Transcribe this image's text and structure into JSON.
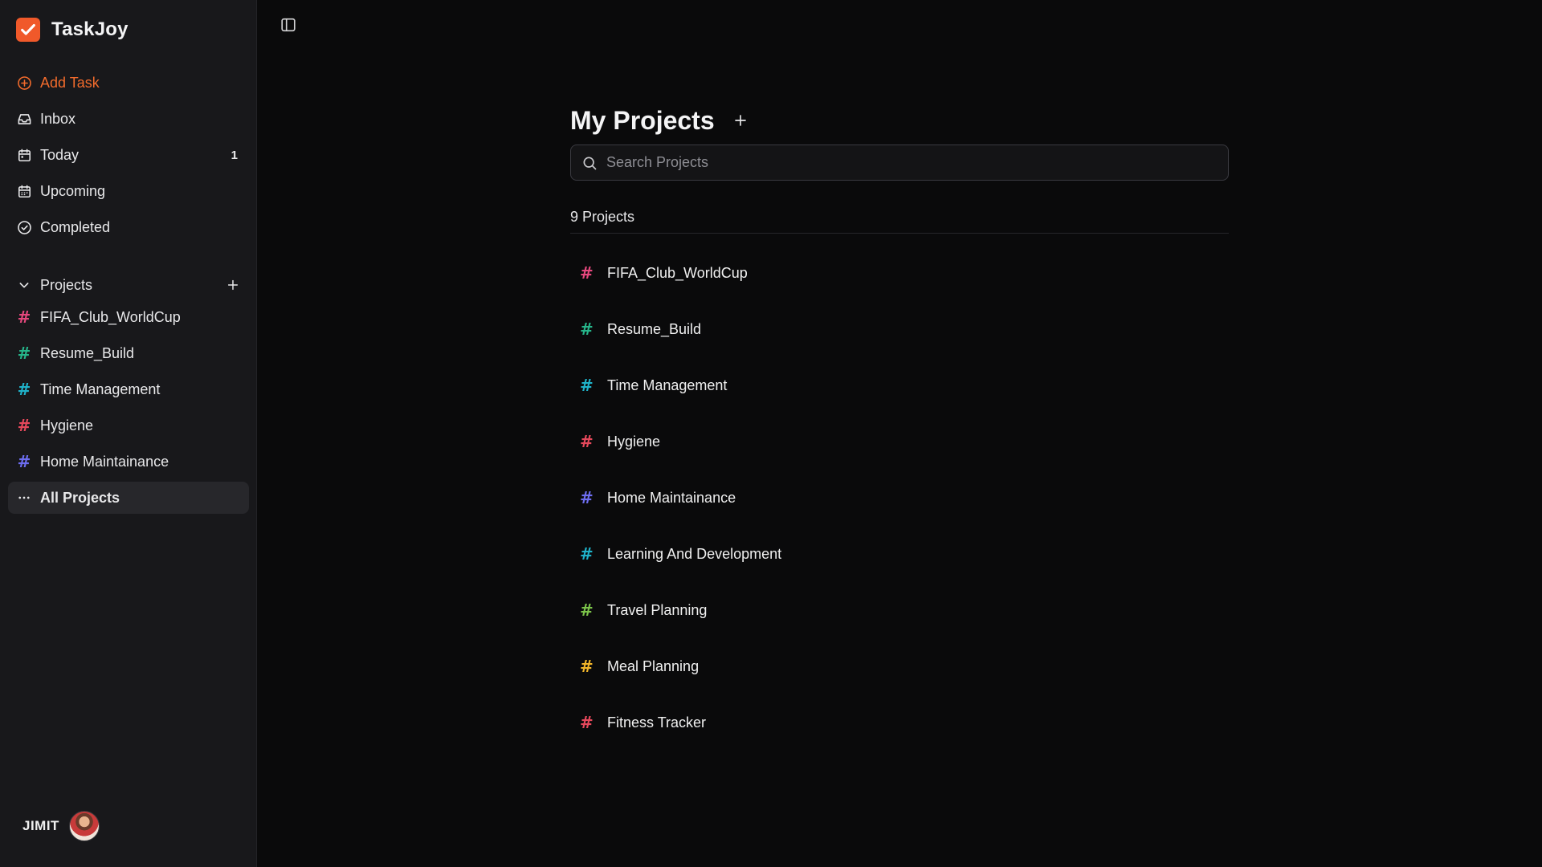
{
  "app": {
    "name": "TaskJoy",
    "accent": "#f0592a"
  },
  "nav": {
    "add_task": "Add Task",
    "inbox": "Inbox",
    "today": "Today",
    "today_count": "1",
    "upcoming": "Upcoming",
    "completed": "Completed"
  },
  "sidebar_projects": {
    "heading": "Projects",
    "items": [
      {
        "label": "FIFA_Club_WorldCup",
        "color": "#e5487d"
      },
      {
        "label": "Resume_Build",
        "color": "#26b58a"
      },
      {
        "label": "Time Management",
        "color": "#1fb2c9"
      },
      {
        "label": "Hygiene",
        "color": "#e5485b"
      },
      {
        "label": "Home Maintainance",
        "color": "#6d6df0"
      }
    ],
    "all_projects": "All Projects"
  },
  "user": {
    "name": "JIMIT"
  },
  "main": {
    "title": "My Projects",
    "search_placeholder": "Search Projects",
    "count_label": "9 Projects",
    "projects": [
      {
        "label": "FIFA_Club_WorldCup",
        "color": "#e5487d"
      },
      {
        "label": "Resume_Build",
        "color": "#26b58a"
      },
      {
        "label": "Time Management",
        "color": "#1fb2c9"
      },
      {
        "label": "Hygiene",
        "color": "#e5485b"
      },
      {
        "label": "Home Maintainance",
        "color": "#6d6df0"
      },
      {
        "label": "Learning And Development",
        "color": "#1fb2c9"
      },
      {
        "label": "Travel Planning",
        "color": "#7bc34a"
      },
      {
        "label": "Meal Planning",
        "color": "#f0b429"
      },
      {
        "label": "Fitness Tracker",
        "color": "#e5485b"
      }
    ]
  }
}
